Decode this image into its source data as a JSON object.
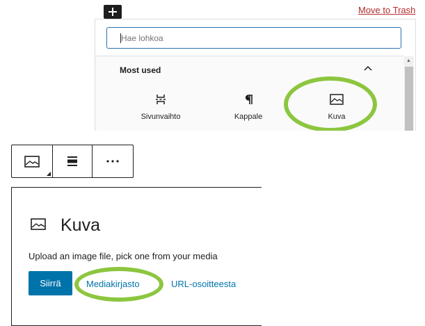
{
  "top_bar": {
    "add_block_icon": "plus-icon",
    "move_to_trash": "Move to Trash"
  },
  "inserter": {
    "search_placeholder": "Hae lohkoa",
    "category_title": "Most used",
    "category_toggle_icon": "chevron-up-icon",
    "blocks": [
      {
        "label": "Sivunvaihto",
        "icon": "page-break-icon"
      },
      {
        "label": "Kappale",
        "icon": "paragraph-icon"
      },
      {
        "label": "Kuva",
        "icon": "image-icon",
        "highlighted": true
      }
    ]
  },
  "block_toolbar": {
    "items": [
      {
        "icon": "image-icon",
        "name": "change-block-type"
      },
      {
        "icon": "align-icon",
        "name": "align"
      },
      {
        "icon": "more-options-icon",
        "name": "more-options"
      }
    ]
  },
  "image_block": {
    "title": "Kuva",
    "title_icon": "image-icon",
    "description": "Upload an image file, pick one from your media",
    "upload_label": "Siirrä",
    "media_library_label": "Mediakirjasto",
    "insert_url_label": "URL-osoitteesta"
  },
  "colors": {
    "highlight": "#8cc63f",
    "accent": "#0073aa",
    "search_border": "#2a6fb0",
    "trash": "#b32d2e"
  }
}
